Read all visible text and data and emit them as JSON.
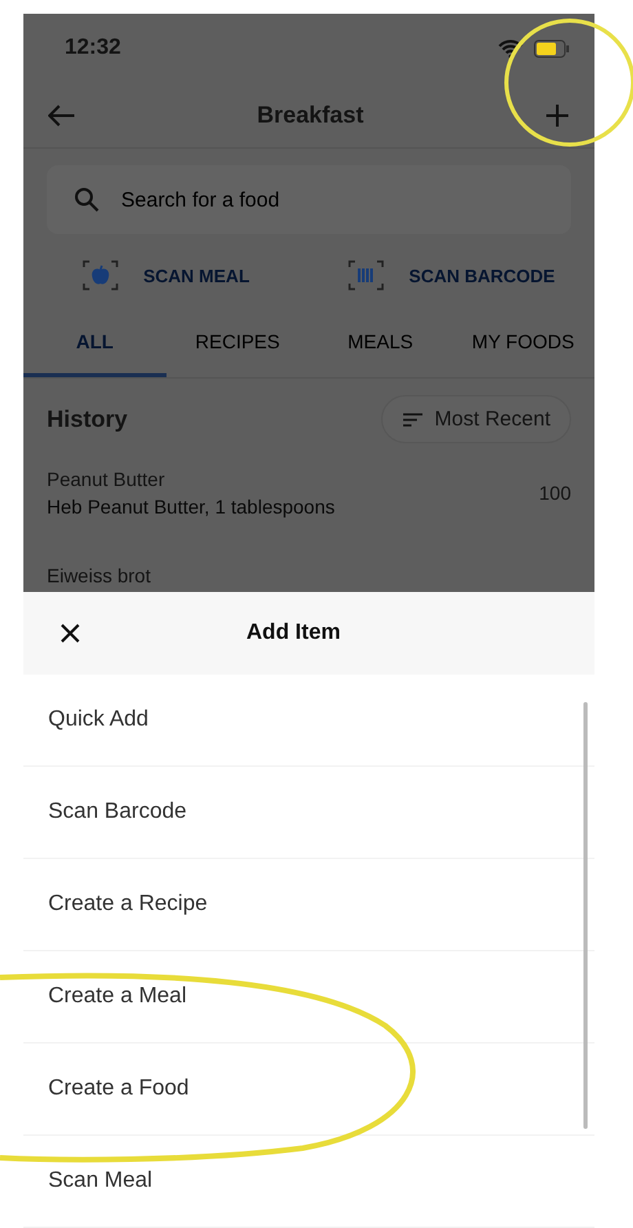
{
  "status_bar": {
    "time": "12:32"
  },
  "nav": {
    "title": "Breakfast"
  },
  "search": {
    "placeholder": "Search for a food"
  },
  "scan_actions": [
    {
      "kind": "meal",
      "label": "SCAN MEAL"
    },
    {
      "kind": "barcode",
      "label": "SCAN BARCODE"
    }
  ],
  "tabs": [
    {
      "label": "ALL",
      "selected": true
    },
    {
      "label": "RECIPES",
      "selected": false
    },
    {
      "label": "MEALS",
      "selected": false
    },
    {
      "label": "MY FOODS",
      "selected": false
    }
  ],
  "history": {
    "title": "History",
    "sort": "Most Recent",
    "rows": [
      {
        "name": "Peanut Butter",
        "detail": "Heb Peanut Butter, 1 tablespoons",
        "value": "100"
      },
      {
        "name": "Eiweiss brot"
      }
    ]
  },
  "sheet": {
    "title": "Add Item",
    "items": [
      "Quick Add",
      "Scan Barcode",
      "Create a Recipe",
      "Create a Meal",
      "Create a Food",
      "Scan Meal"
    ]
  }
}
